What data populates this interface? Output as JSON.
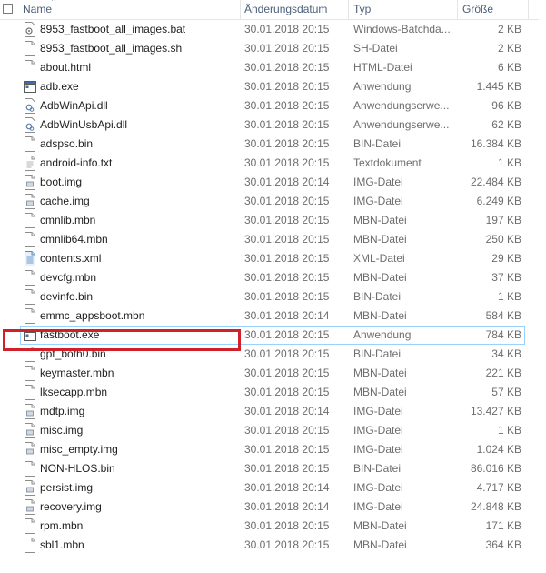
{
  "columns": {
    "name": "Name",
    "date": "Änderungsdatum",
    "type": "Typ",
    "size": "Größe"
  },
  "files": [
    {
      "name": "8953_fastboot_all_images.bat",
      "date": "30.01.2018 20:15",
      "type": "Windows-Batchda...",
      "size": "2 KB",
      "icon": "batch-file-icon"
    },
    {
      "name": "8953_fastboot_all_images.sh",
      "date": "30.01.2018 20:15",
      "type": "SH-Datei",
      "size": "2 KB",
      "icon": "generic-file-icon"
    },
    {
      "name": "about.html",
      "date": "30.01.2018 20:15",
      "type": "HTML-Datei",
      "size": "6 KB",
      "icon": "generic-file-icon"
    },
    {
      "name": "adb.exe",
      "date": "30.01.2018 20:15",
      "type": "Anwendung",
      "size": "1.445 KB",
      "icon": "exe-file-icon"
    },
    {
      "name": "AdbWinApi.dll",
      "date": "30.01.2018 20:15",
      "type": "Anwendungserwe...",
      "size": "96 KB",
      "icon": "dll-file-icon"
    },
    {
      "name": "AdbWinUsbApi.dll",
      "date": "30.01.2018 20:15",
      "type": "Anwendungserwe...",
      "size": "62 KB",
      "icon": "dll-file-icon"
    },
    {
      "name": "adspso.bin",
      "date": "30.01.2018 20:15",
      "type": "BIN-Datei",
      "size": "16.384 KB",
      "icon": "generic-file-icon"
    },
    {
      "name": "android-info.txt",
      "date": "30.01.2018 20:15",
      "type": "Textdokument",
      "size": "1 KB",
      "icon": "text-file-icon"
    },
    {
      "name": "boot.img",
      "date": "30.01.2018 20:14",
      "type": "IMG-Datei",
      "size": "22.484 KB",
      "icon": "disk-image-icon"
    },
    {
      "name": "cache.img",
      "date": "30.01.2018 20:15",
      "type": "IMG-Datei",
      "size": "6.249 KB",
      "icon": "disk-image-icon"
    },
    {
      "name": "cmnlib.mbn",
      "date": "30.01.2018 20:15",
      "type": "MBN-Datei",
      "size": "197 KB",
      "icon": "generic-file-icon"
    },
    {
      "name": "cmnlib64.mbn",
      "date": "30.01.2018 20:15",
      "type": "MBN-Datei",
      "size": "250 KB",
      "icon": "generic-file-icon"
    },
    {
      "name": "contents.xml",
      "date": "30.01.2018 20:15",
      "type": "XML-Datei",
      "size": "29 KB",
      "icon": "xml-file-icon"
    },
    {
      "name": "devcfg.mbn",
      "date": "30.01.2018 20:15",
      "type": "MBN-Datei",
      "size": "37 KB",
      "icon": "generic-file-icon"
    },
    {
      "name": "devinfo.bin",
      "date": "30.01.2018 20:15",
      "type": "BIN-Datei",
      "size": "1 KB",
      "icon": "generic-file-icon"
    },
    {
      "name": "emmc_appsboot.mbn",
      "date": "30.01.2018 20:14",
      "type": "MBN-Datei",
      "size": "584 KB",
      "icon": "generic-file-icon"
    },
    {
      "name": "fastboot.exe",
      "date": "30.01.2018 20:15",
      "type": "Anwendung",
      "size": "784 KB",
      "icon": "exe-file-icon",
      "selected": true
    },
    {
      "name": "gpt_both0.bin",
      "date": "30.01.2018 20:15",
      "type": "BIN-Datei",
      "size": "34 KB",
      "icon": "generic-file-icon"
    },
    {
      "name": "keymaster.mbn",
      "date": "30.01.2018 20:15",
      "type": "MBN-Datei",
      "size": "221 KB",
      "icon": "generic-file-icon"
    },
    {
      "name": "lksecapp.mbn",
      "date": "30.01.2018 20:15",
      "type": "MBN-Datei",
      "size": "57 KB",
      "icon": "generic-file-icon"
    },
    {
      "name": "mdtp.img",
      "date": "30.01.2018 20:14",
      "type": "IMG-Datei",
      "size": "13.427 KB",
      "icon": "disk-image-icon"
    },
    {
      "name": "misc.img",
      "date": "30.01.2018 20:15",
      "type": "IMG-Datei",
      "size": "1 KB",
      "icon": "disk-image-icon"
    },
    {
      "name": "misc_empty.img",
      "date": "30.01.2018 20:15",
      "type": "IMG-Datei",
      "size": "1.024 KB",
      "icon": "disk-image-icon"
    },
    {
      "name": "NON-HLOS.bin",
      "date": "30.01.2018 20:15",
      "type": "BIN-Datei",
      "size": "86.016 KB",
      "icon": "generic-file-icon"
    },
    {
      "name": "persist.img",
      "date": "30.01.2018 20:14",
      "type": "IMG-Datei",
      "size": "4.717 KB",
      "icon": "disk-image-icon"
    },
    {
      "name": "recovery.img",
      "date": "30.01.2018 20:14",
      "type": "IMG-Datei",
      "size": "24.848 KB",
      "icon": "disk-image-icon"
    },
    {
      "name": "rpm.mbn",
      "date": "30.01.2018 20:15",
      "type": "MBN-Datei",
      "size": "171 KB",
      "icon": "generic-file-icon"
    },
    {
      "name": "sbl1.mbn",
      "date": "30.01.2018 20:15",
      "type": "MBN-Datei",
      "size": "364 KB",
      "icon": "generic-file-icon"
    }
  ],
  "colors": {
    "highlight_box": "#d0202a",
    "selection_border": "#99d1ff",
    "header_text": "#4c607a",
    "detail_text": "#6d6d6d"
  }
}
